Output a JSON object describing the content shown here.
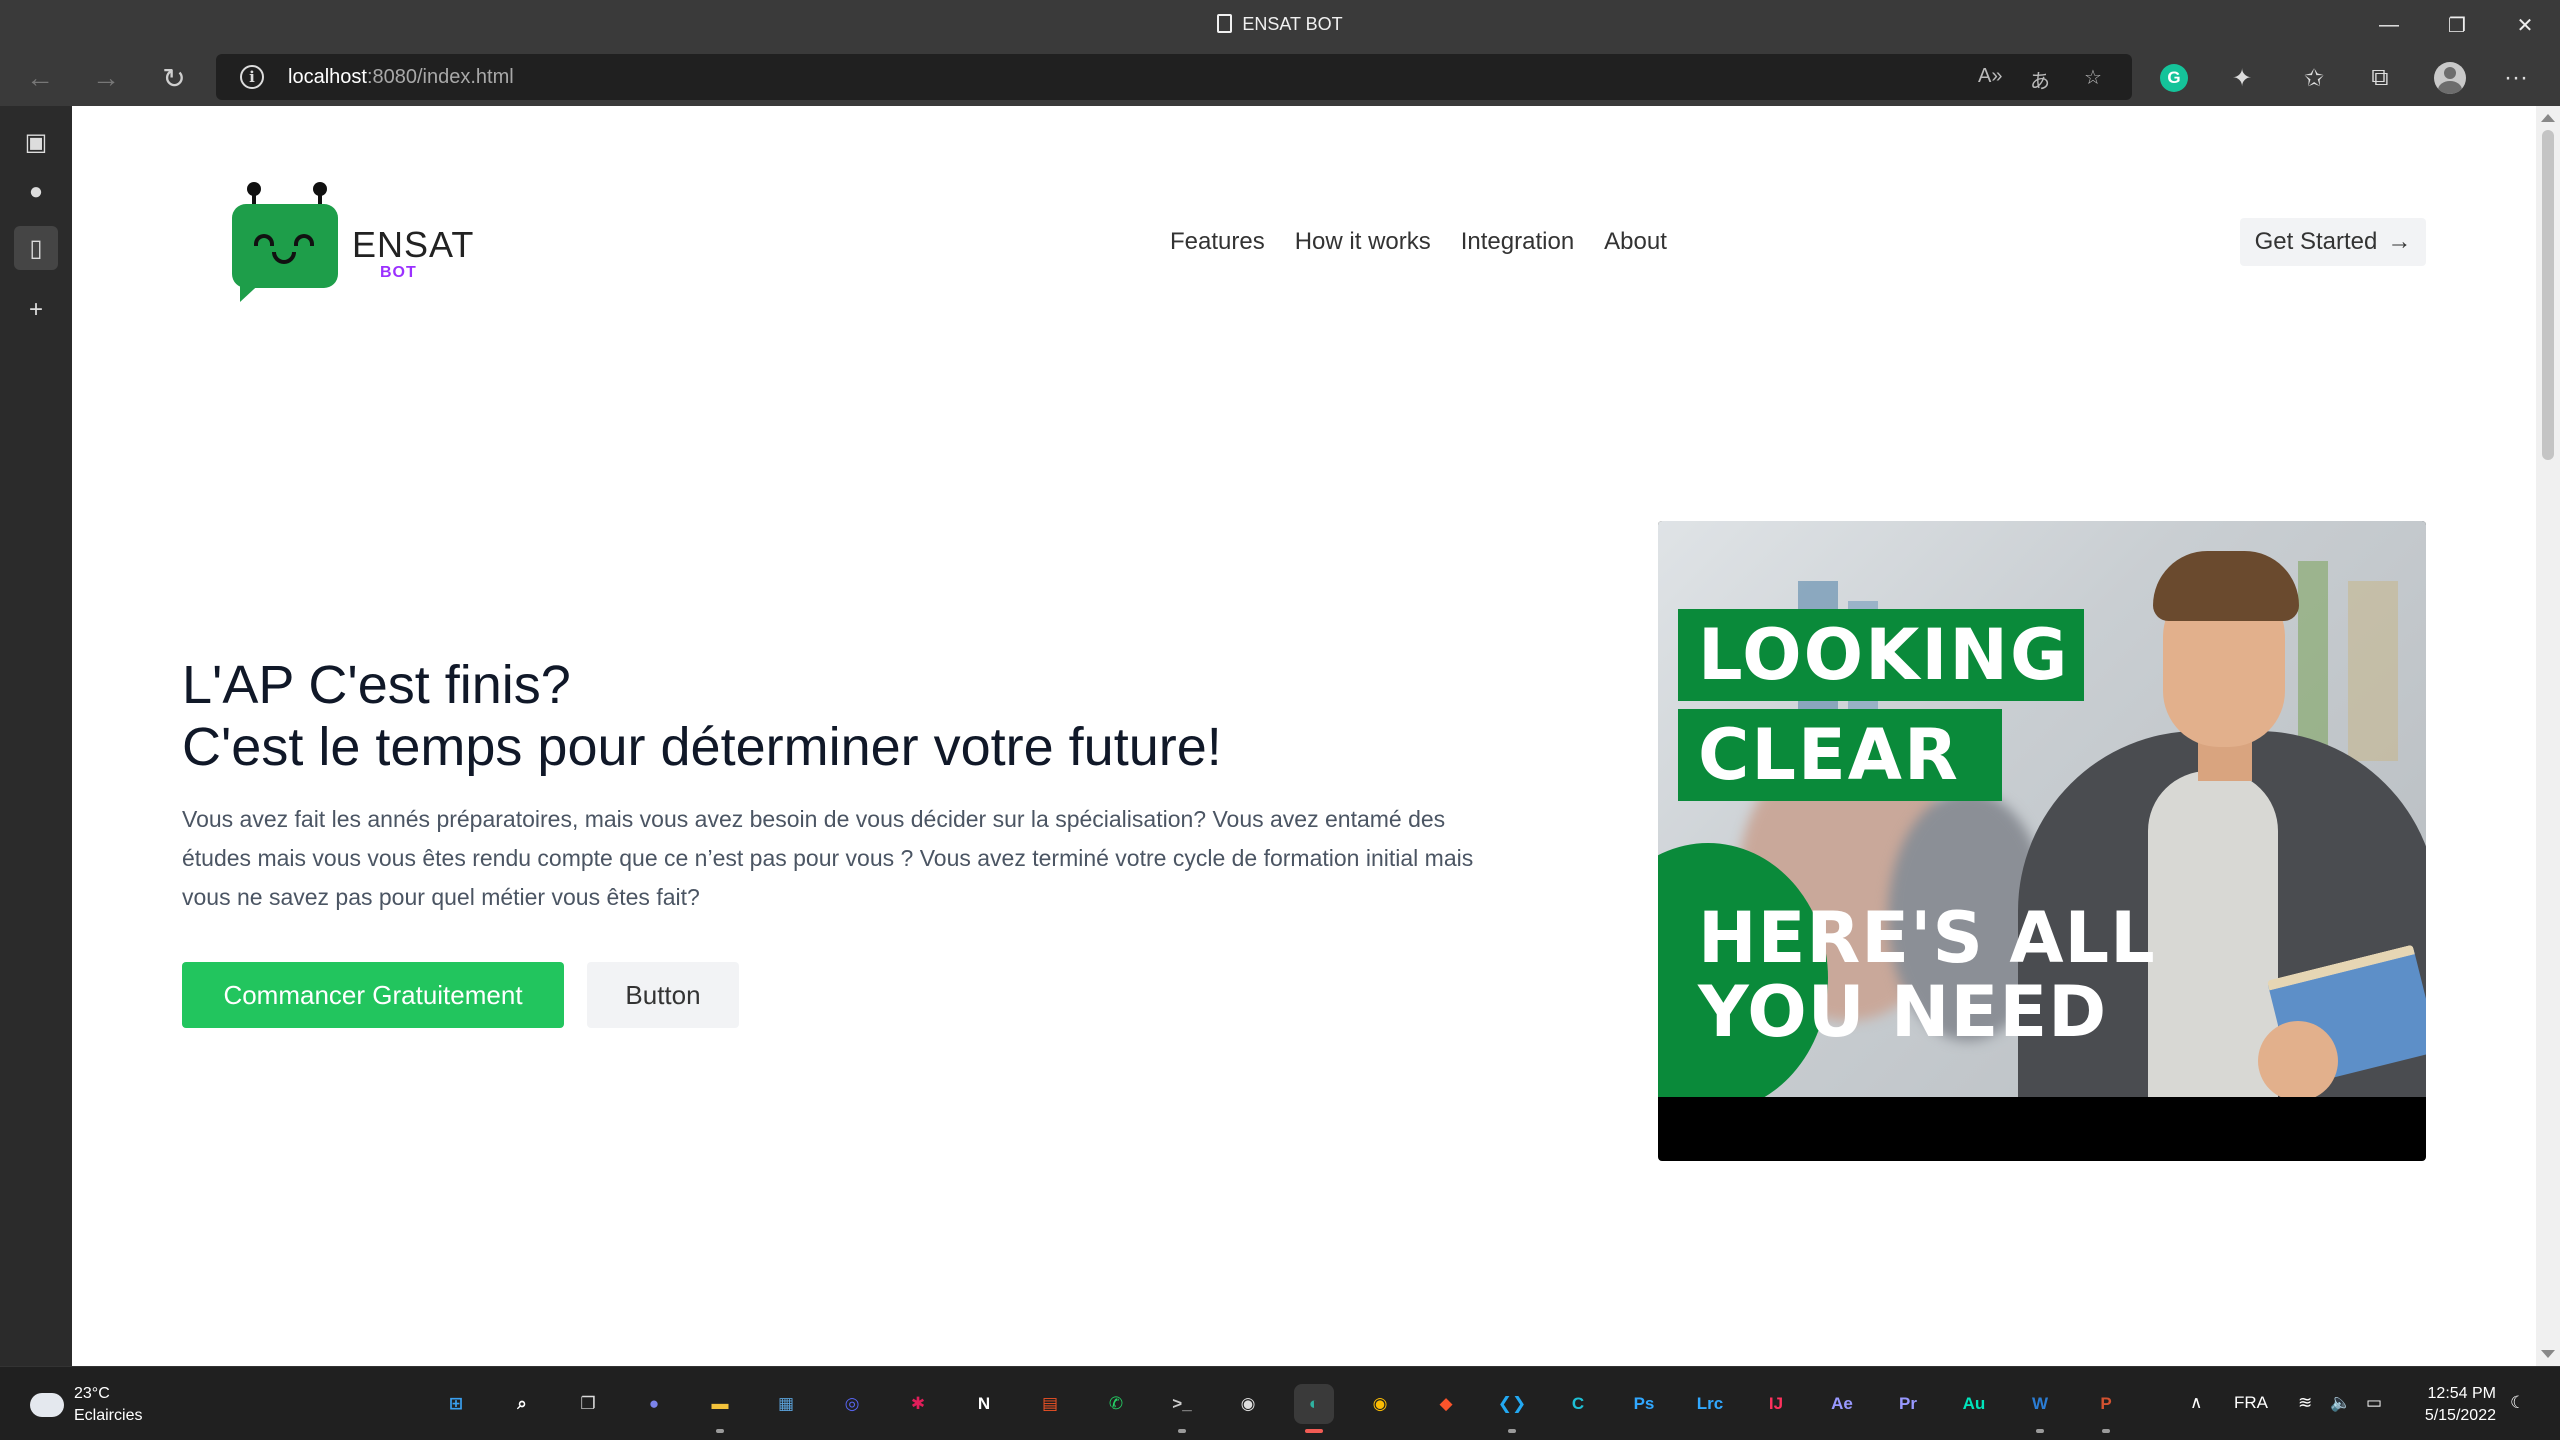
{
  "window": {
    "title": "ENSAT BOT",
    "minimize_glyph": "—",
    "restore_glyph": "❐",
    "close_glyph": "✕"
  },
  "browser": {
    "back_glyph": "←",
    "forward_glyph": "→",
    "refresh_glyph": "↻",
    "url_host": "localhost",
    "url_rest": ":8080/index.html",
    "read_aloud_glyph": "A»",
    "translate_glyph": "あ",
    "favorite_glyph": "☆",
    "grammarly_label": "G",
    "extensions_glyph": "✦",
    "favorites_glyph": "✩",
    "collections_glyph": "⧉",
    "more_glyph": "···"
  },
  "sidebar": {
    "tabs_glyph": "▣",
    "github_glyph": "●",
    "page_glyph": "▯",
    "add_glyph": "+"
  },
  "site": {
    "logo_word": "ENSAT",
    "logo_sub": "BOT",
    "nav": [
      "Features",
      "How it works",
      "Integration",
      "About"
    ],
    "get_started": "Get Started",
    "get_started_arrow": "→",
    "hero_line1": "L'AP C'est finis?",
    "hero_line2": "C'est le temps pour déterminer votre future!",
    "hero_text": "Vous avez fait les annés préparatoires, mais vous avez besoin de vous décider sur la spécialisation? Vous avez entamé des études mais vous vous êtes rendu compte que ce n’est pas pour vous ? Vous avez terminé votre cycle de formation initial mais vous ne savez pas pour quel métier vous êtes fait?",
    "btn_primary": "Commancer Gratuitement",
    "btn_secondary": "Button",
    "image": {
      "banner1": "LOOKING",
      "banner2": "CLEAR",
      "caption_line1": "HERE'S ALL",
      "caption_line2": "YOU NEED",
      "brand_green": "#0a8a3a"
    }
  },
  "taskbar": {
    "weather_temp": "23°C",
    "weather_desc": "Eclaircies",
    "apps": [
      {
        "name": "start",
        "label": "⊞",
        "color": "#3aa0f0"
      },
      {
        "name": "search",
        "label": "⌕",
        "color": "#ffffff"
      },
      {
        "name": "task-view",
        "label": "❐",
        "color": "#dddddd"
      },
      {
        "name": "teams",
        "label": "●",
        "color": "#7b83eb"
      },
      {
        "name": "file-explorer",
        "label": "▬",
        "color": "#f3c23b"
      },
      {
        "name": "photos",
        "label": "▦",
        "color": "#5aa0d8"
      },
      {
        "name": "discord",
        "label": "◎",
        "color": "#5865f2"
      },
      {
        "name": "slack",
        "label": "✱",
        "color": "#e01e5a"
      },
      {
        "name": "notion",
        "label": "N",
        "color": "#ffffff"
      },
      {
        "name": "store",
        "label": "▤",
        "color": "#f35325"
      },
      {
        "name": "whatsapp",
        "label": "✆",
        "color": "#25d366"
      },
      {
        "name": "terminal",
        "label": ">_",
        "color": "#cccccc"
      },
      {
        "name": "obs",
        "label": "◉",
        "color": "#dddddd"
      },
      {
        "name": "edge",
        "label": "◐",
        "color": "#2fb2a1"
      },
      {
        "name": "chrome",
        "label": "◉",
        "color": "#fbbc04"
      },
      {
        "name": "brave",
        "label": "◆",
        "color": "#fb542b"
      },
      {
        "name": "vscode",
        "label": "❮❯",
        "color": "#23a9f2"
      },
      {
        "name": "canva",
        "label": "C",
        "color": "#1ec0d6"
      },
      {
        "name": "photoshop",
        "label": "Ps",
        "color": "#31a8ff"
      },
      {
        "name": "lightroom",
        "label": "Lrc",
        "color": "#31a8ff"
      },
      {
        "name": "jetbrains",
        "label": "IJ",
        "color": "#fe315d"
      },
      {
        "name": "after-effects",
        "label": "Ae",
        "color": "#9999ff"
      },
      {
        "name": "premiere",
        "label": "Pr",
        "color": "#9999ff"
      },
      {
        "name": "audition",
        "label": "Au",
        "color": "#00e4bb"
      },
      {
        "name": "word",
        "label": "W",
        "color": "#2b7cd3"
      },
      {
        "name": "powerpoint",
        "label": "P",
        "color": "#d35230"
      }
    ],
    "tray_chevron": "∧",
    "language": "FRA",
    "wifi_glyph": "≋",
    "volume_glyph": "🔈",
    "battery_glyph": "▭",
    "time": "12:54 PM",
    "date": "5/15/2022",
    "notif_glyph": "☾"
  }
}
